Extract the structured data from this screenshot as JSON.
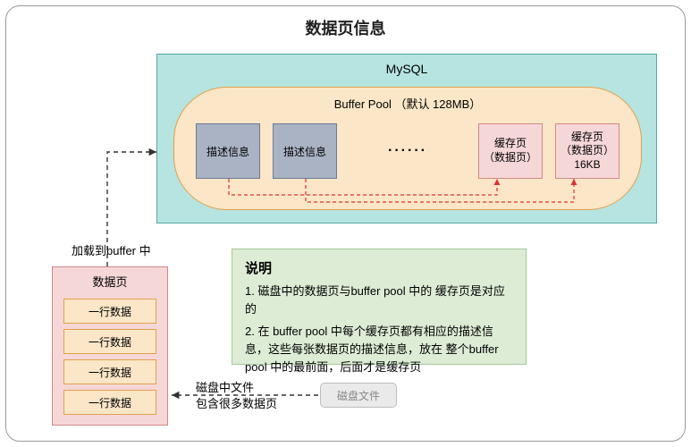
{
  "title": "数据页信息",
  "mysql": {
    "label": "MySQL",
    "bufferPool": {
      "label": "Buffer Pool  （默认 128MB）",
      "desc1": "描述信息",
      "desc2": "描述信息",
      "ellipsis": "······",
      "cache1": "缓存页\n（数据页）",
      "cache2": "缓存页\n（数据页）\n16KB"
    }
  },
  "loadLabel": "加载到buffer 中",
  "dataPage": {
    "title": "数据页",
    "rows": [
      "一行数据",
      "一行数据",
      "一行数据",
      "一行数据"
    ]
  },
  "diskText": "磁盘中文件\n包含很多数据页",
  "diskFile": "磁盘文件",
  "explain": {
    "title": "说明",
    "line1": "1. 磁盘中的数据页与buffer pool 中的 缓存页是对应的",
    "line2": "2. 在 buffer pool 中每个缓存页都有相应的描述信息，这些每张数据页的描述信息，放在 整个buffer pool 中的最前面，后面才是缓存页"
  }
}
